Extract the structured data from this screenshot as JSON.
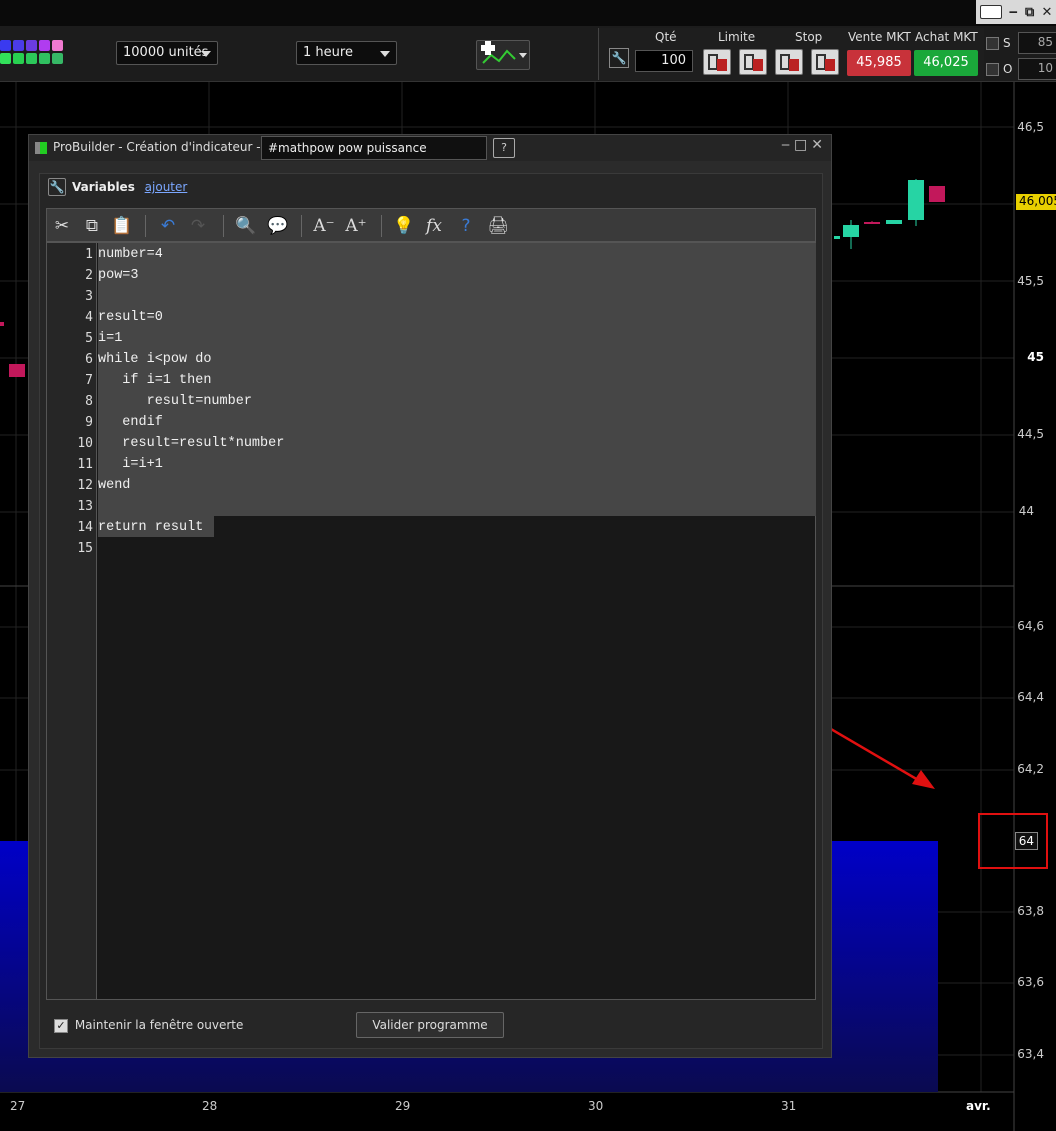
{
  "toolbar": {
    "units_select": "10000 unités",
    "period_select": "1 heure",
    "qty_label": "Qté",
    "qty_value": "100",
    "limit_label": "Limite",
    "stop_label": "Stop",
    "sell_label": "Vente MKT",
    "buy_label": "Achat MKT",
    "sell_price": "45,985",
    "buy_price": "46,025",
    "s_label": "S",
    "o_label": "O",
    "s_value": "85",
    "o_value": "10",
    "sell_color": "#c8323a",
    "buy_color": "#1aa83a"
  },
  "chart": {
    "upper_axis": [
      "46,5",
      "46",
      "45,5",
      "45",
      "44,5",
      "44"
    ],
    "current_price": "46,005",
    "lower_axis": [
      "64,6",
      "64,4",
      "64,2",
      "64",
      "63,8",
      "63,6",
      "63,4"
    ],
    "highlighted_value": "64",
    "x_axis": [
      "27",
      "28",
      "29",
      "30",
      "31",
      "avr."
    ]
  },
  "probuilder": {
    "window_title": "ProBuilder - Création d'indicateur -",
    "indicator_name": "#mathpow pow puissance",
    "variables_label": "Variables",
    "add_link": "ajouter",
    "code_lines": [
      "number=4",
      "pow=3",
      "",
      "result=0",
      "i=1",
      "while i<pow do",
      "   if i=1 then",
      "      result=number",
      "   endif",
      "   result=result*number",
      "   i=i+1",
      "wend",
      "",
      "return result",
      ""
    ],
    "line_numbers": [
      "1",
      "2",
      "3",
      "4",
      "5",
      "6",
      "7",
      "8",
      "9",
      "10",
      "11",
      "12",
      "13",
      "14",
      "15"
    ],
    "keep_open_label": "Maintenir la fenêtre ouverte",
    "validate_button": "Valider programme"
  }
}
